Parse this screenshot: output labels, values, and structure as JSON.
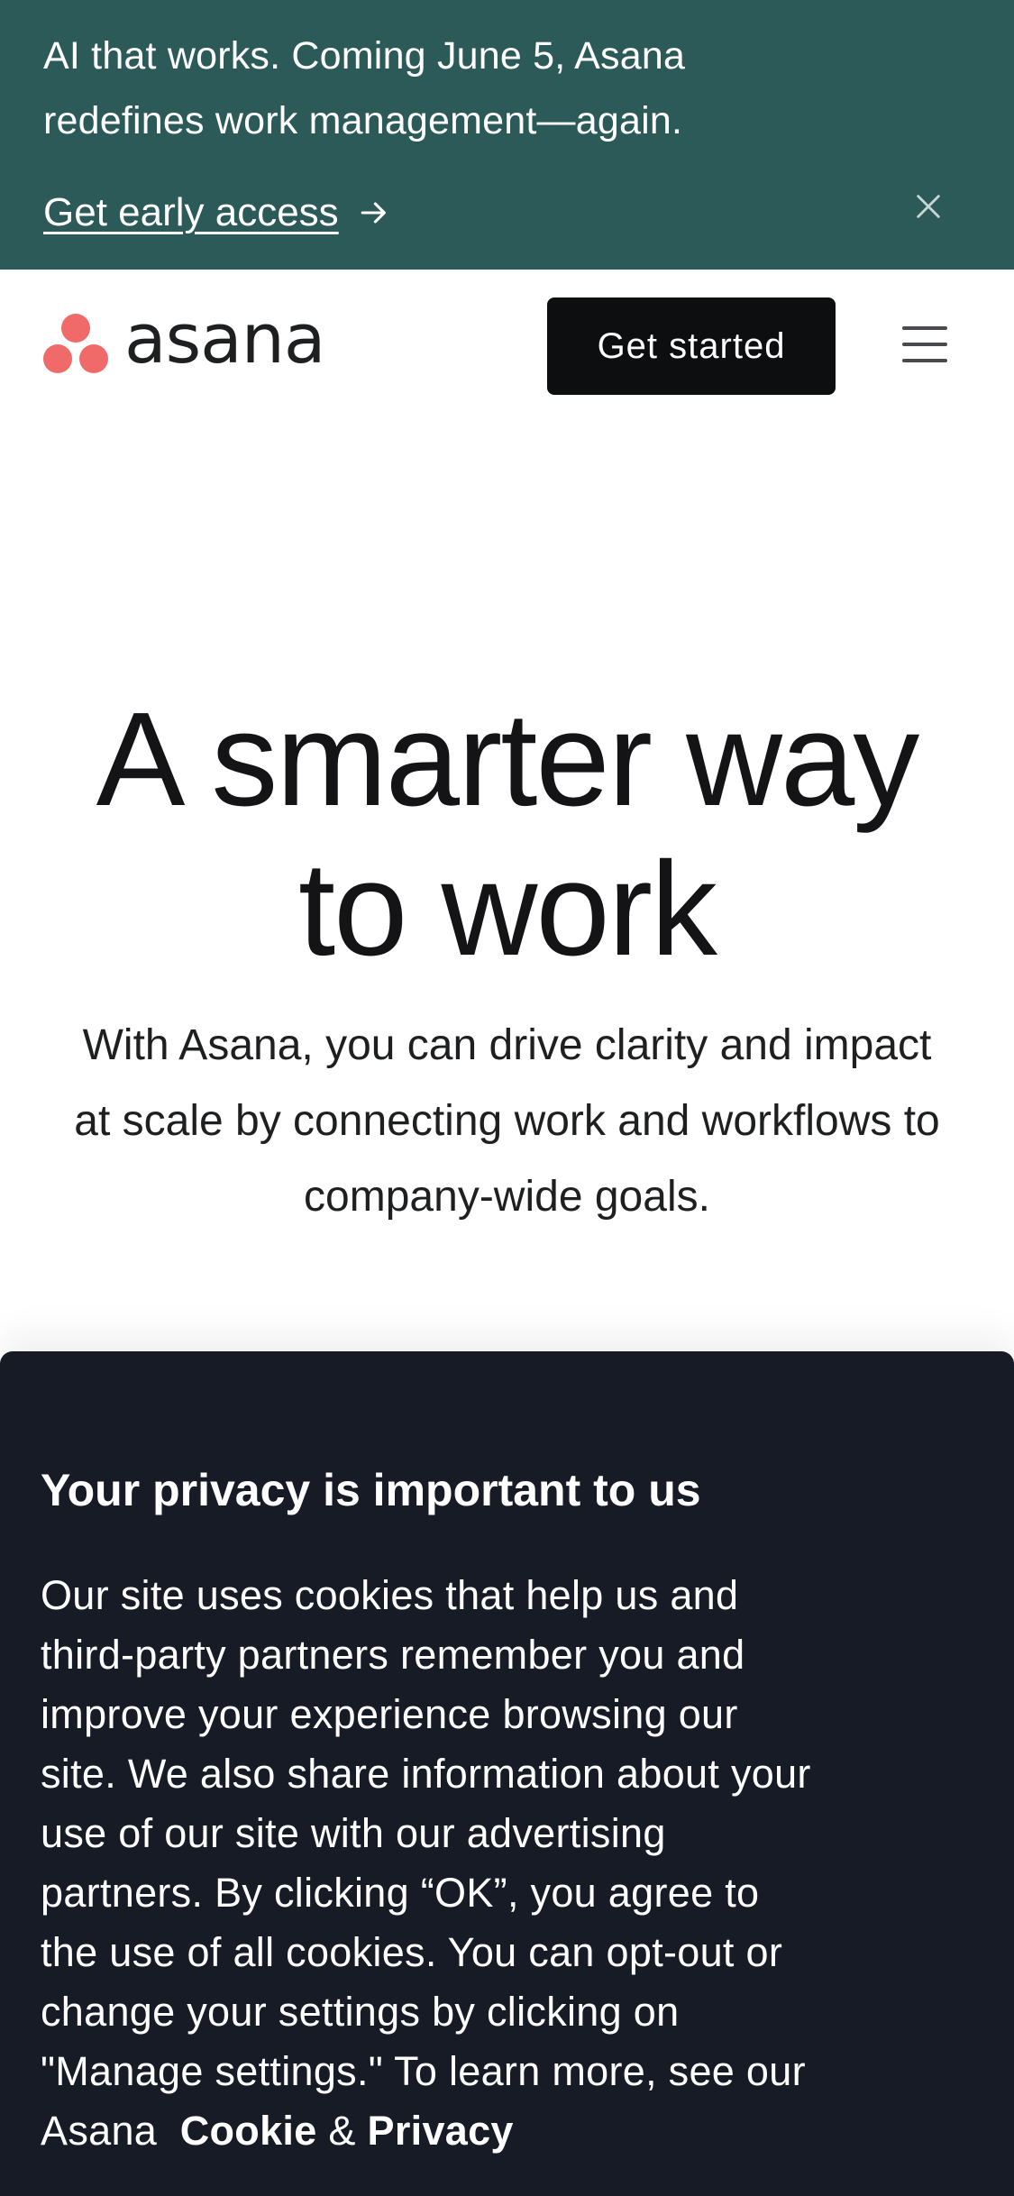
{
  "banner": {
    "message": "AI that works. Coming June 5, Asana redefines work management—again.",
    "link_label": "Get early access",
    "link_icon": "arrow-right-icon",
    "close_icon": "close-icon",
    "background_color": "#2b5a58"
  },
  "header": {
    "logo_text": "asana",
    "logo_color": "#f06a6a",
    "cta_label": "Get started",
    "menu_icon": "hamburger-menu-icon"
  },
  "hero": {
    "title_line1": "A smarter way",
    "title_line2": "to work",
    "subtitle": "With Asana, you can drive clarity and impact at scale by connecting work and workflows to company-wide goals."
  },
  "cookie_banner": {
    "title": "Your privacy is important to us",
    "body": "Our site uses cookies that help us and third-party partners remember you and improve your experience browsing our site. We also share information about your use of our site with our advertising partners. By clicking “OK”, you agree to the use of all cookies. You can opt-out or change your settings by clicking on \"Manage settings.\" To learn more, see our Asana",
    "cookie_link": "Cookie",
    "connector": "&",
    "privacy_link": "Privacy",
    "background_color": "#171b26"
  }
}
